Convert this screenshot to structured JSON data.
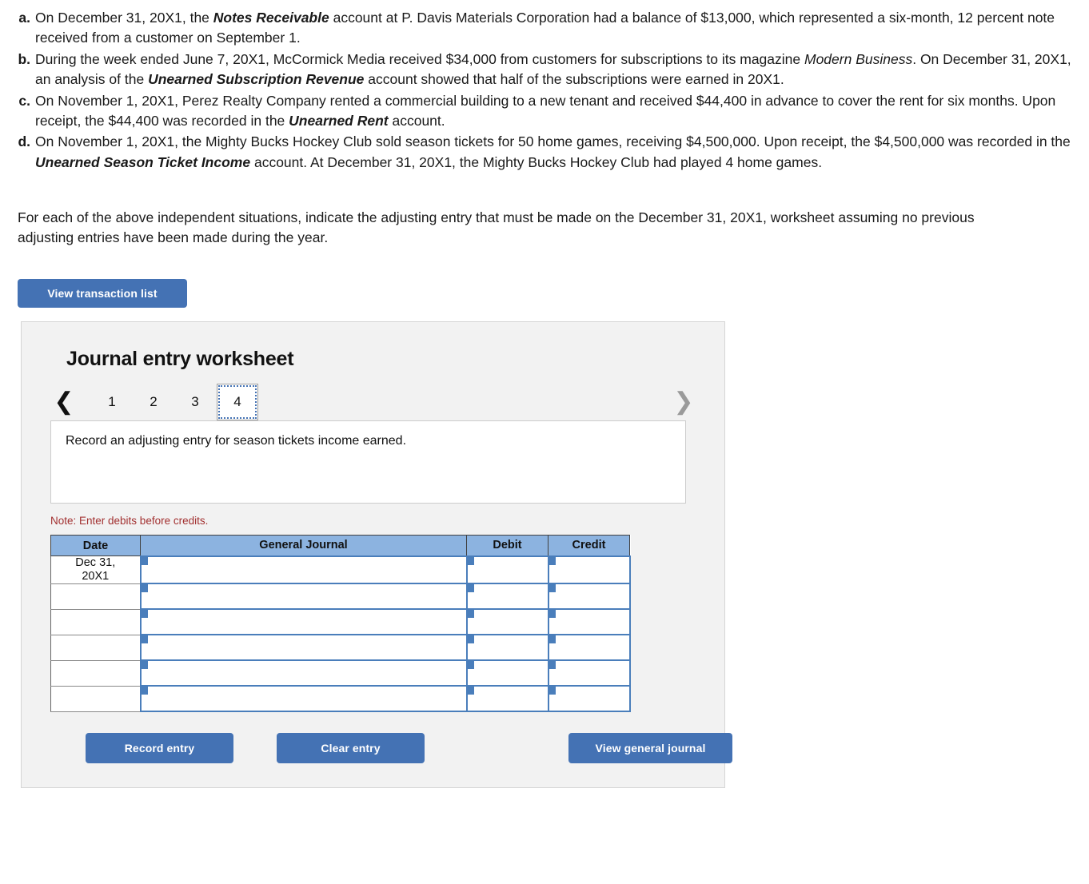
{
  "problem": {
    "situations": [
      {
        "marker": "a.",
        "segments": [
          {
            "t": "On December 31, 20X1, the ",
            "s": "normal"
          },
          {
            "t": "Notes Receivable",
            "s": "bolditalic"
          },
          {
            "t": " account at P. Davis Materials Corporation had a balance of $13,000, which represented a six-month, 12 percent note received from a customer on September 1.",
            "s": "normal"
          }
        ]
      },
      {
        "marker": "b.",
        "segments": [
          {
            "t": "During the week ended June 7, 20X1, McCormick Media received $34,000 from customers for subscriptions to its magazine ",
            "s": "normal"
          },
          {
            "t": "Modern Business",
            "s": "italic"
          },
          {
            "t": ". On December 31, 20X1, an analysis of the ",
            "s": "normal"
          },
          {
            "t": "Unearned Subscription Revenue",
            "s": "bolditalic"
          },
          {
            "t": " account showed that half of the subscriptions were earned in 20X1.",
            "s": "normal"
          }
        ]
      },
      {
        "marker": "c.",
        "segments": [
          {
            "t": "On November 1, 20X1, Perez Realty Company rented a commercial building to a new tenant and received $44,400 in advance to cover the rent for six months. Upon receipt, the $44,400 was recorded in the ",
            "s": "normal"
          },
          {
            "t": "Unearned Rent",
            "s": "bolditalic"
          },
          {
            "t": " account.",
            "s": "normal"
          }
        ]
      },
      {
        "marker": "d.",
        "segments": [
          {
            "t": "On November 1, 20X1, the Mighty Bucks Hockey Club sold season tickets for 50 home games, receiving $4,500,000. Upon receipt, the $4,500,000 was recorded in the ",
            "s": "normal"
          },
          {
            "t": "Unearned Season Ticket Income",
            "s": "bolditalic"
          },
          {
            "t": " account. At December 31, 20X1, the Mighty Bucks Hockey Club had played 4 home games.",
            "s": "normal"
          }
        ]
      }
    ],
    "instruction": "For each of the above independent situations, indicate the adjusting entry that must be made on the December 31, 20X1, worksheet assuming no previous adjusting entries have been made during the year."
  },
  "toolbar": {
    "view_transaction_list_label": "View transaction list"
  },
  "worksheet": {
    "title": "Journal entry worksheet",
    "nav": {
      "prev_icon": "chevron-left-icon",
      "next_icon": "chevron-right-icon"
    },
    "tabs": [
      {
        "label": "1",
        "active": false
      },
      {
        "label": "2",
        "active": false
      },
      {
        "label": "3",
        "active": false
      },
      {
        "label": "4",
        "active": true
      }
    ],
    "description": "Record an adjusting entry for season tickets income earned.",
    "note": "Note: Enter debits before credits.",
    "table": {
      "headers": [
        "Date",
        "General Journal",
        "Debit",
        "Credit"
      ],
      "rows": [
        {
          "date": "Dec 31,\n20X1",
          "general_journal": "",
          "debit": "",
          "credit": ""
        },
        {
          "date": "",
          "general_journal": "",
          "debit": "",
          "credit": ""
        },
        {
          "date": "",
          "general_journal": "",
          "debit": "",
          "credit": ""
        },
        {
          "date": "",
          "general_journal": "",
          "debit": "",
          "credit": ""
        },
        {
          "date": "",
          "general_journal": "",
          "debit": "",
          "credit": ""
        },
        {
          "date": "",
          "general_journal": "",
          "debit": "",
          "credit": ""
        }
      ]
    },
    "actions": {
      "record_entry_label": "Record entry",
      "clear_entry_label": "Clear entry",
      "view_general_journal_label": "View general journal"
    }
  },
  "colors": {
    "button_blue": "#4472b4",
    "table_header_blue": "#8cb3e0",
    "cell_border_blue": "#4a7ebb",
    "note_red": "#a23030",
    "panel_bg": "#f2f2f2"
  }
}
